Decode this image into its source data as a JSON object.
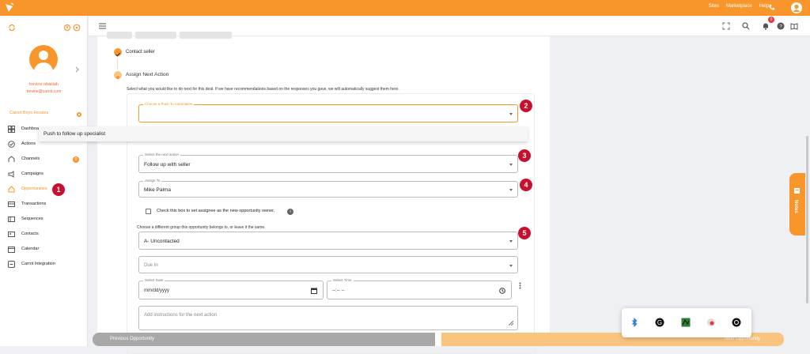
{
  "topbar": {
    "links": [
      "Sites",
      "Marketplace",
      "Help"
    ],
    "logo_icon": "carrot-logo-icon",
    "phone_icon": "phone-icon",
    "account_icon": "account-circle-icon"
  },
  "sidebar": {
    "user_name": "trevine obaiiiah",
    "user_email": "trevine@carrot.com",
    "team_name": "Carrot Boys Houses",
    "actions_badge": "0",
    "items": [
      {
        "label": "Dashboard",
        "icon": "dashboard-icon"
      },
      {
        "label": "Actions",
        "icon": "check-circle-icon"
      },
      {
        "label": "Channels",
        "icon": "channels-icon"
      },
      {
        "label": "Campaigns",
        "icon": "megaphone-icon"
      },
      {
        "label": "Opportunities",
        "icon": "home-icon",
        "active": true
      },
      {
        "label": "Transactions",
        "icon": "transactions-icon"
      },
      {
        "label": "Sequences",
        "icon": "sequences-icon"
      },
      {
        "label": "Contacts",
        "icon": "contacts-icon"
      },
      {
        "label": "Calendar",
        "icon": "calendar-icon"
      },
      {
        "label": "Carrot Integration",
        "icon": "integration-icon"
      }
    ]
  },
  "header": {
    "notification_count": "0"
  },
  "markers": [
    "1",
    "2",
    "3",
    "4",
    "5"
  ],
  "steps": {
    "completed": "Contact seller",
    "current": "Assign Next Action",
    "intro": "Select what you would like to do next for this deal. If we have recommendations based on the responses you gave, we will automatically suggest them here."
  },
  "form": {
    "automation": {
      "label": "Choose a Push To Automation",
      "value": ""
    },
    "automation_option": "Push to follow up specialist",
    "next_action": {
      "label": "Select the next action",
      "value": "Follow up with seller"
    },
    "assign_to": {
      "label": "Assign To",
      "value": "Mike Palma"
    },
    "checkbox_label": "Check this box to set assignee as the new opportunity owner.",
    "info": "i",
    "group_label": "Choose a different group this opportunity belongs to, or leave it the same.",
    "group": {
      "value": "A- Uncontacted"
    },
    "due_in": {
      "placeholder": "Due In"
    },
    "select_date": {
      "label": "Select Date",
      "placeholder": "mm/dd/yyyy"
    },
    "select_time": {
      "label": "Select Time",
      "placeholder": "--:-- --"
    },
    "instructions": {
      "placeholder": "Add instructions for the next action"
    }
  },
  "notes_tab": "Notes",
  "footer": {
    "prev": "Previous Opportunity",
    "next": "Next Opportunity"
  },
  "extensions": [
    "bluetooth-icon",
    "grammarly-icon",
    "extension-green-icon",
    "record-icon",
    "extension-round-icon"
  ],
  "colors": {
    "brand": "#f8962b",
    "marker": "#c8102e"
  }
}
